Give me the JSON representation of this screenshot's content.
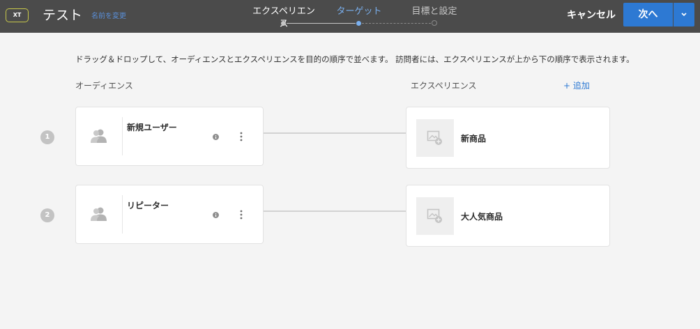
{
  "header": {
    "badge": "XT",
    "title": "テスト",
    "rename_label": "名前を変更",
    "steps": [
      {
        "label": "エクスペリエンス",
        "state": "done"
      },
      {
        "label": "ターゲット",
        "state": "current"
      },
      {
        "label": "目標と設定",
        "state": "todo"
      }
    ],
    "cancel_label": "キャンセル",
    "next_label": "次へ"
  },
  "main": {
    "instruction": "ドラッグ＆ドロップして、オーディエンスとエクスペリエンスを目的の順序で並べます。 訪問者には、エクスペリエンスが上から下の順序で表示されます。",
    "audience_heading": "オーディエンス",
    "experience_heading": "エクスペリエンス",
    "add_label": "+ 追加",
    "rows": [
      {
        "number": "1",
        "audience": "新規ユーザー",
        "experience": "新商品"
      },
      {
        "number": "2",
        "audience": "リピーター",
        "experience": "大人気商品"
      }
    ]
  },
  "colors": {
    "header_bg": "#4b4b4b",
    "accent_blue": "#2d79d3",
    "active_step": "#7ab0ef",
    "page_bg": "#f4f4f4"
  },
  "icons": [
    "users-icon",
    "info-icon",
    "more-vertical-icon",
    "image-add-icon",
    "chevron-down-icon"
  ]
}
